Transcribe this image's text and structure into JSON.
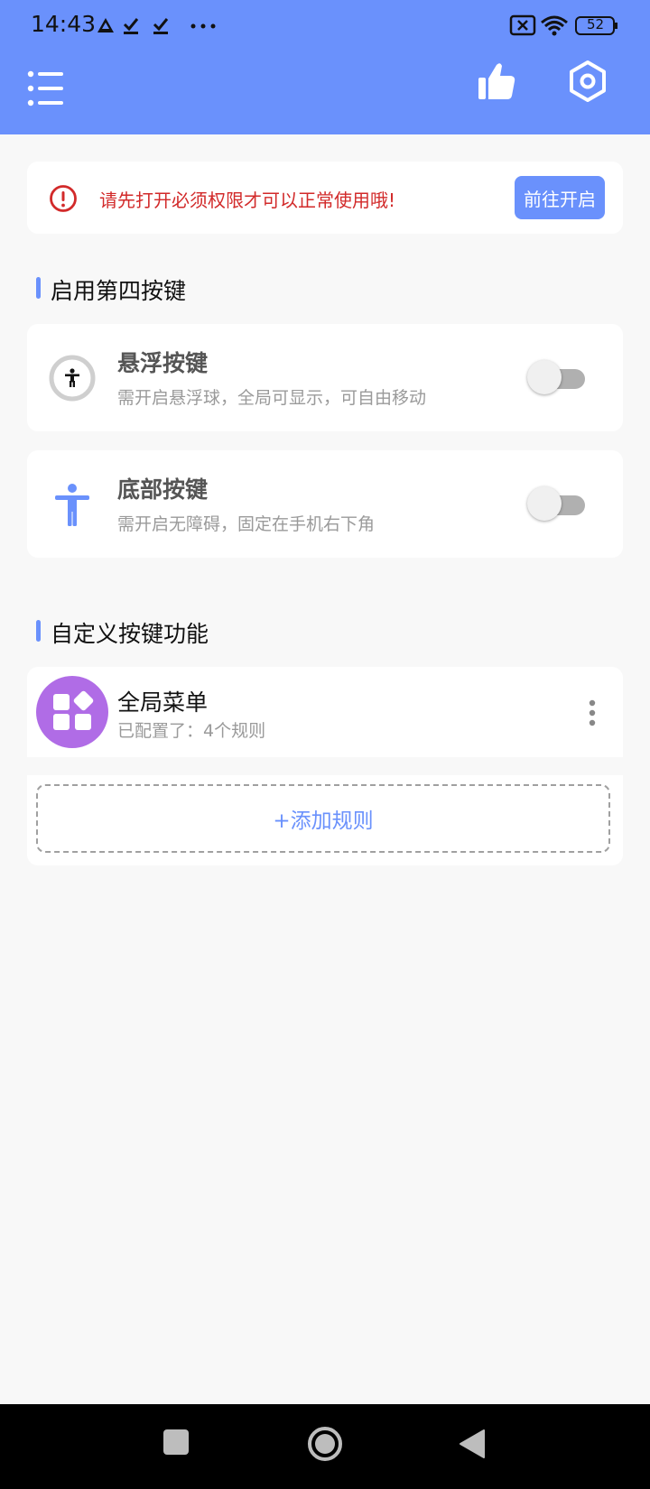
{
  "status_bar": {
    "time": "14:43",
    "battery": "52"
  },
  "header": {
    "menu_icon": "menu-list-icon",
    "like_icon": "thumbs-up-icon",
    "settings_icon": "settings-hexagon-icon"
  },
  "notice": {
    "text": "请先打开必须权限才可以正常使用哦!",
    "button_label": "前往开启",
    "icon": "alert-circle-icon"
  },
  "section_fourth_key": {
    "title": "启用第四按键"
  },
  "features": [
    {
      "title": "悬浮按键",
      "desc": "需开启悬浮球，全局可显示，可自由移动",
      "icon": "accessibility-circle-icon",
      "enabled": false
    },
    {
      "title": "底部按键",
      "desc": "需开启无障碍，固定在手机右下角",
      "icon": "accessibility-person-icon",
      "enabled": false
    }
  ],
  "section_custom": {
    "title": "自定义按键功能"
  },
  "rule": {
    "title": "全局菜单",
    "subtitle": "已配置了：4个规则",
    "icon": "apps-grid-icon"
  },
  "add_rule": {
    "label": "+添加规则"
  },
  "colors": {
    "accent": "#6a91fc",
    "warning": "#d22a2a",
    "avatar": "#b06ce6"
  }
}
